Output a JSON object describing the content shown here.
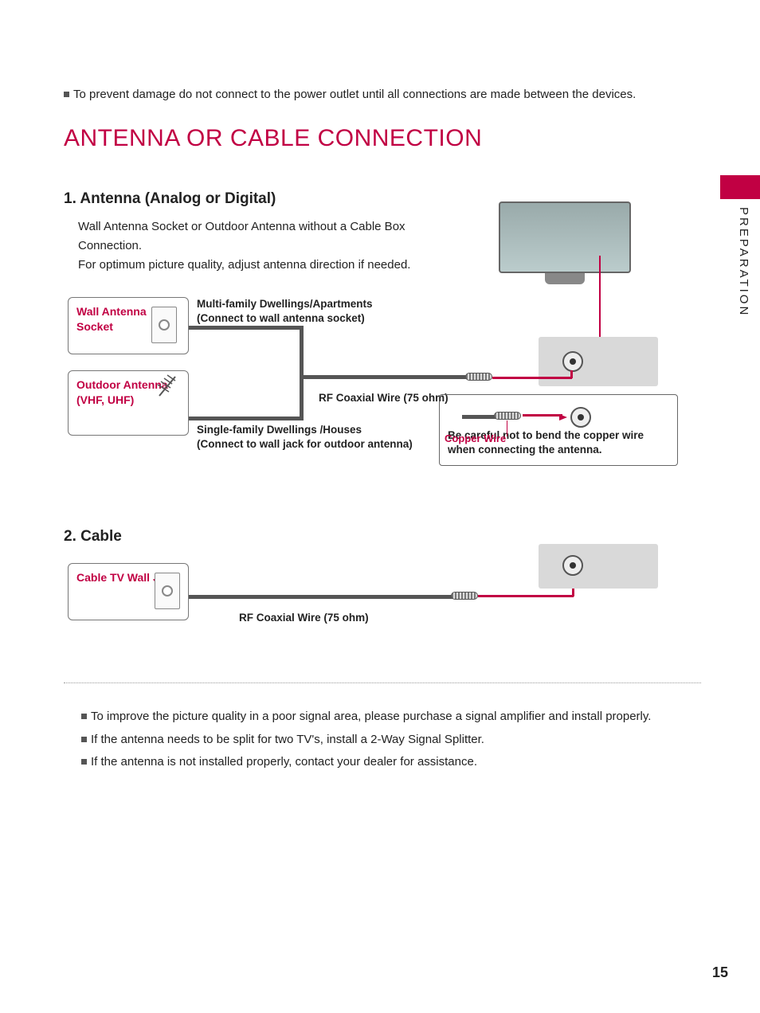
{
  "sideTab": "PREPARATION",
  "pageNumber": "15",
  "topWarning": "To prevent damage do not connect to the power outlet until all connections are made between the devices.",
  "title": "ANTENNA OR CABLE CONNECTION",
  "section1": {
    "heading": "1. Antenna (Analog or Digital)",
    "para1": "Wall Antenna Socket or Outdoor Antenna without a Cable Box Connection.",
    "para2": "For optimum picture quality, adjust antenna direction if needed.",
    "labels": {
      "wallSocket": "Wall Antenna Socket",
      "outdoorAntenna": "Outdoor Antenna (VHF, UHF)",
      "multiFamily1": "Multi-family Dwellings/Apartments",
      "multiFamily2": "(Connect to wall antenna socket)",
      "singleFamily1": "Single-family Dwellings /Houses",
      "singleFamily2": "(Connect to wall jack for outdoor antenna)",
      "rfWire": "RF Coaxial Wire (75 ohm)",
      "copperWire": "Copper Wire",
      "copperWarn": "Be careful not to bend the copper wire when connecting the antenna."
    }
  },
  "section2": {
    "heading": "2. Cable",
    "labels": {
      "cableJack": "Cable TV Wall Jack",
      "rfWire": "RF Coaxial Wire (75 ohm)"
    }
  },
  "notes": [
    "To improve the picture quality in a poor signal area, please purchase a signal amplifier and install properly.",
    "If the antenna needs to be split for two TV's, install a 2-Way Signal Splitter.",
    "If the antenna is not installed properly, contact your dealer for assistance."
  ]
}
